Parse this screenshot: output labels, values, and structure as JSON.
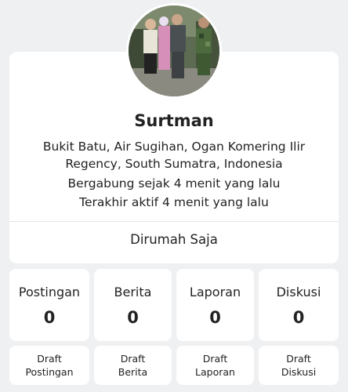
{
  "profile": {
    "name": "Surtman",
    "location": "Bukit Batu, Air Sugihan, Ogan Komering Ilir Regency, South Sumatra, Indonesia",
    "joined": "Bergabung sejak 4 menit yang lalu",
    "last_active": "Terakhir aktif 4 menit yang lalu",
    "status": "Dirumah Saja"
  },
  "stats": [
    {
      "label": "Postingan",
      "value": "0"
    },
    {
      "label": "Berita",
      "value": "0"
    },
    {
      "label": "Laporan",
      "value": "0"
    },
    {
      "label": "Diskusi",
      "value": "0"
    }
  ],
  "drafts": [
    {
      "label": "Draft\nPostingan"
    },
    {
      "label": "Draft\nBerita"
    },
    {
      "label": "Draft\nLaporan"
    },
    {
      "label": "Draft\nDiskusi"
    }
  ]
}
